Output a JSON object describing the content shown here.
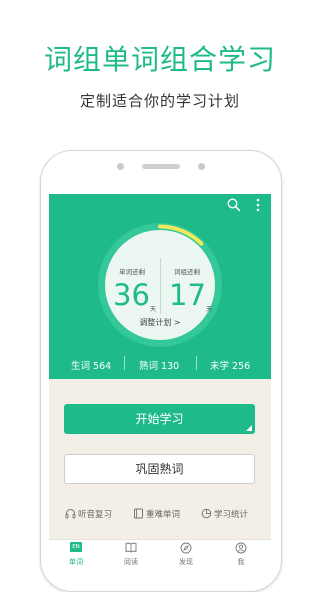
{
  "promo": {
    "headline": "词组单词组合学习",
    "subline": "定制适合你的学习计划"
  },
  "app": {
    "header_icons": [
      "search-icon",
      "more-vert-icon"
    ],
    "progress": {
      "left_label": "单词还剩",
      "left_value": "36",
      "left_unit": "天",
      "right_label": "词组还剩",
      "right_value": "17",
      "right_unit": "天",
      "plan_link": "调整计划 >"
    },
    "stats": {
      "new_words": "生词 564",
      "familiar_words": "熟词 130",
      "unlearned": "未学 256"
    },
    "buttons": {
      "start": "开始学习",
      "review": "巩固熟词"
    },
    "tools": [
      {
        "label": "听音复习",
        "icon": "headphones-icon"
      },
      {
        "label": "重难单词",
        "icon": "book-icon"
      },
      {
        "label": "学习统计",
        "icon": "pie-chart-icon"
      }
    ],
    "tabs": [
      {
        "label": "单词",
        "icon": "EN",
        "active": true
      },
      {
        "label": "阅读",
        "icon": "open-book-icon",
        "active": false
      },
      {
        "label": "发现",
        "icon": "compass-icon",
        "active": false
      },
      {
        "label": "我",
        "icon": "user-icon",
        "active": false
      }
    ],
    "colors": {
      "primary": "#1fba8a",
      "accent_arc": "#f0e95a",
      "background": "#f3efe6"
    }
  }
}
